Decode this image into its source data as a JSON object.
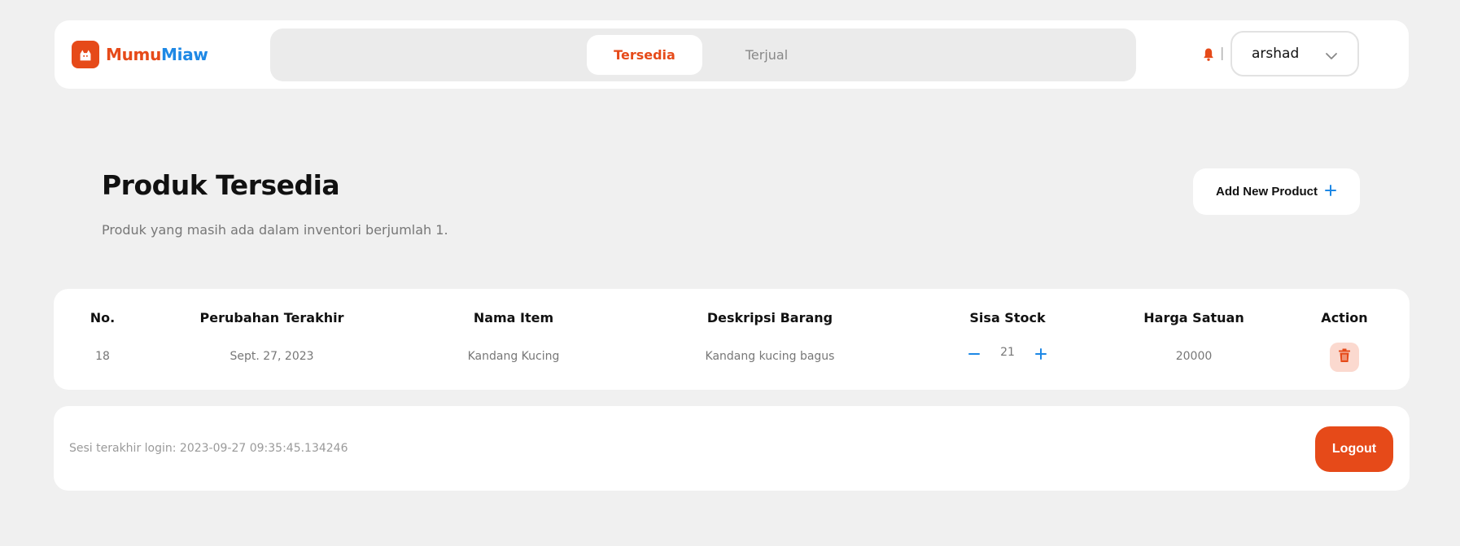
{
  "colors": {
    "brand_orange": "#e64a19",
    "brand_blue": "#1e88e5",
    "background": "#f0f0f0"
  },
  "brand": {
    "part1": "Mumu",
    "part2": "Miaw",
    "logo_icon": "cat-icon"
  },
  "tabs": [
    {
      "label": "Tersedia",
      "active": true
    },
    {
      "label": "Terjual",
      "active": false
    }
  ],
  "user": {
    "name": "arshad",
    "separator": "|"
  },
  "header": {
    "title": "Produk Tersedia",
    "subtitle": "Produk yang masih ada dalam inventori berjumlah 1.",
    "add_button_label": "Add New Product"
  },
  "table": {
    "headers": [
      "No.",
      "Perubahan Terakhir",
      "Nama Item",
      "Deskripsi Barang",
      "Sisa Stock",
      "Harga Satuan",
      "Action"
    ],
    "rows": [
      {
        "no": "18",
        "date": "Sept. 27, 2023",
        "name": "Kandang Kucing",
        "description": "Kandang kucing bagus",
        "stock": "21",
        "price": "20000"
      }
    ]
  },
  "footer": {
    "session": "Sesi terakhir login: 2023-09-27 09:35:45.134246",
    "logout_label": "Logout"
  }
}
